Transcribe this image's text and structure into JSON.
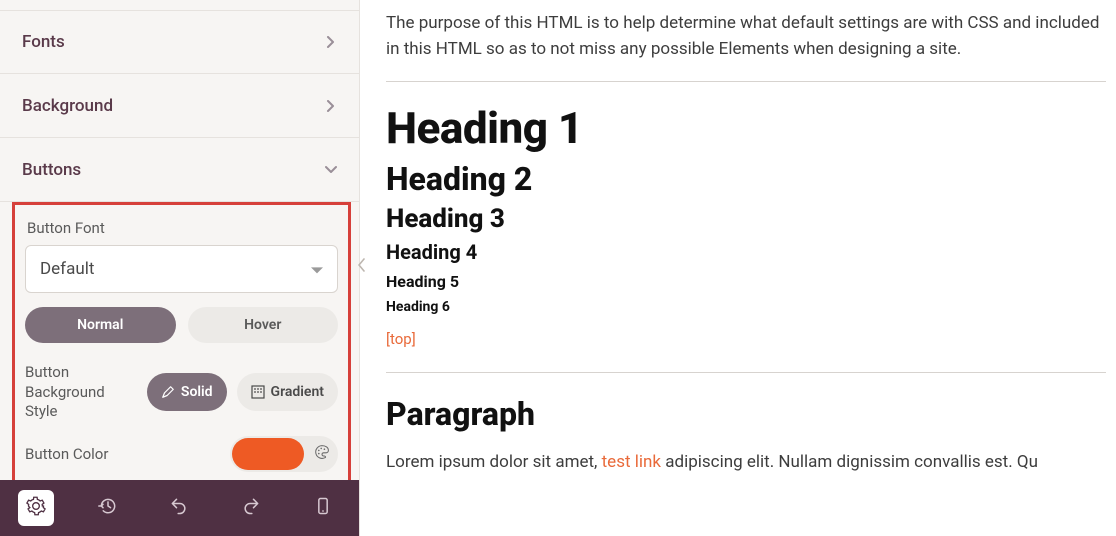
{
  "sidebar": {
    "sections": [
      {
        "label": "Fonts",
        "expanded": false
      },
      {
        "label": "Background",
        "expanded": false
      },
      {
        "label": "Buttons",
        "expanded": true
      }
    ],
    "button_font": {
      "label": "Button Font",
      "value": "Default"
    },
    "state_tabs": {
      "normal": "Normal",
      "hover": "Hover",
      "active": "normal"
    },
    "bg_style": {
      "label": "Button Background Style",
      "solid": "Solid",
      "gradient": "Gradient",
      "active": "solid"
    },
    "button_color": {
      "label": "Button Color",
      "value": "#ee5a24"
    }
  },
  "bottombar": {
    "items": [
      "settings",
      "history",
      "undo",
      "redo",
      "device"
    ]
  },
  "preview": {
    "intro": "The purpose of this HTML is to help determine what default settings are with CSS and included in this HTML so as to not miss any possible Elements when designing a site.",
    "h1": "Heading 1",
    "h2": "Heading 2",
    "h3": "Heading 3",
    "h4": "Heading 4",
    "h5": "Heading 5",
    "h6": "Heading 6",
    "top_link": "[top]",
    "para_title": "Paragraph",
    "para_pre": "Lorem ipsum dolor sit amet, ",
    "para_link": "test link",
    "para_post": " adipiscing elit. Nullam dignissim convallis est. Qu"
  },
  "colors": {
    "accent": "#ee5a24",
    "brand_dark": "#4f3043",
    "pill_active": "#7d6f7a",
    "highlight_border": "#d6403a"
  }
}
